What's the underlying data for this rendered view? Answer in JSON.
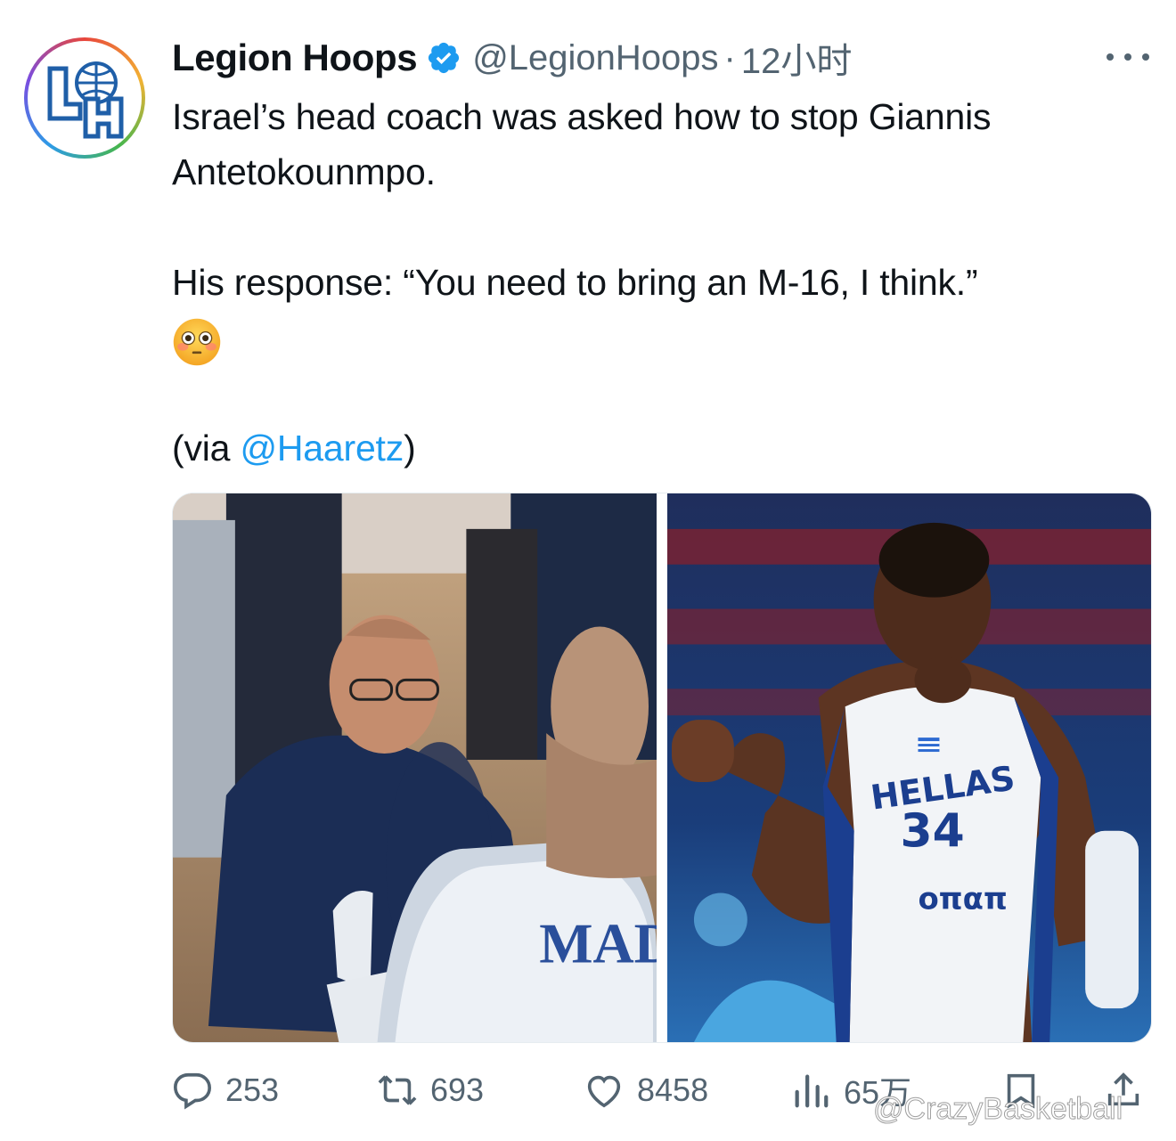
{
  "tweet": {
    "display_name": "Legion Hoops",
    "handle": "@LegionHoops",
    "separator": "·",
    "timestamp": "12小时",
    "lines": [
      "Israel’s head coach was asked how to stop Giannis Antetokounmpo.",
      "His response: “You need to bring an M-16, I think.”"
    ],
    "via_prefix": "(via ",
    "via_mention": "@Haaretz",
    "via_suffix": ")",
    "emoji": "flushed-face",
    "media": {
      "left_photo_text": "MAD",
      "right_photo_texts": [
        "HELLAS",
        "34",
        "οπαπ"
      ]
    },
    "metrics": {
      "replies": "253",
      "reposts": "693",
      "likes": "8458",
      "views": "65万"
    }
  },
  "watermark": "@CrazyBasketball",
  "colors": {
    "link": "#1d9bf0",
    "verified": "#1d9bf0",
    "secondary_text": "#536471",
    "primary_text": "#0f1419"
  },
  "icons": [
    "verified-badge-icon",
    "more-icon",
    "reply-icon",
    "repost-icon",
    "like-icon",
    "views-icon",
    "bookmark-icon",
    "share-icon"
  ]
}
